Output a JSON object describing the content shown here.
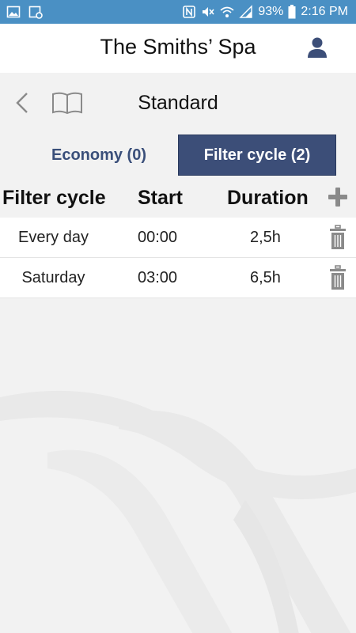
{
  "status_bar": {
    "battery": "93%",
    "time": "2:16 PM",
    "left_icons": [
      "image-icon",
      "screenshot-icon"
    ],
    "right_icons": [
      "nfc-icon",
      "mute-icon",
      "wifi-icon",
      "signal-icon",
      "battery-icon"
    ]
  },
  "header": {
    "title": "The Smiths’ Spa",
    "user_icon": "user-icon"
  },
  "section": {
    "title": "Standard",
    "back_icon": "chevron-left-icon",
    "book_icon": "book-icon"
  },
  "tabs": [
    {
      "label": "Economy (0)",
      "active": false
    },
    {
      "label": "Filter cycle (2)",
      "active": true
    }
  ],
  "table": {
    "columns": [
      "Filter cycle",
      "Start",
      "Duration"
    ],
    "add_icon": "plus-icon",
    "delete_icon": "trash-icon",
    "rows": [
      {
        "cycle": "Every day",
        "start": "00:00",
        "duration": "2,5h"
      },
      {
        "cycle": "Saturday",
        "start": "03:00",
        "duration": "6,5h"
      }
    ]
  },
  "colors": {
    "status_bar": "#4a90c4",
    "accent": "#3c4e78",
    "icon_gray": "#8a8a8a",
    "background": "#f2f2f2"
  }
}
